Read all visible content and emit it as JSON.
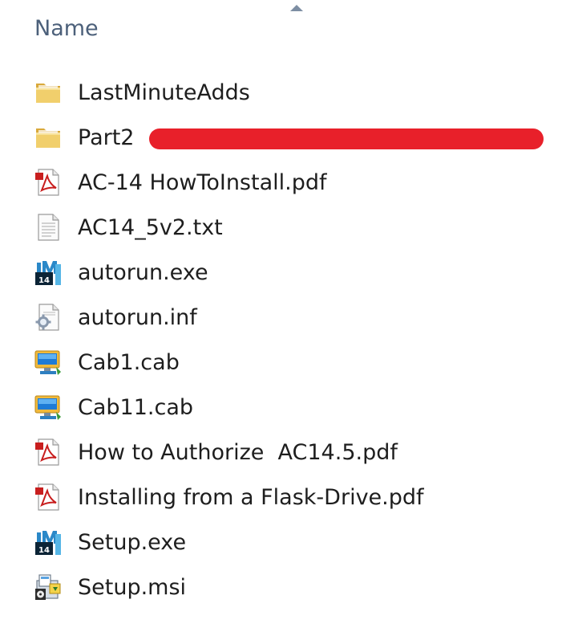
{
  "header": {
    "name_label": "Name",
    "sort_icon": "sort-ascending-icon"
  },
  "files": [
    {
      "label": "LastMinuteAdds",
      "icon": "folder-icon"
    },
    {
      "label": "Part2",
      "icon": "folder-icon"
    },
    {
      "label": "AC-14 HowToInstall.pdf",
      "icon": "pdf-icon"
    },
    {
      "label": "AC14_5v2.txt",
      "icon": "text-file-icon"
    },
    {
      "label": "autorun.exe",
      "icon": "app-exe-icon"
    },
    {
      "label": "autorun.inf",
      "icon": "settings-file-icon"
    },
    {
      "label": "Cab1.cab",
      "icon": "cabinet-icon"
    },
    {
      "label": "Cab11.cab",
      "icon": "cabinet-icon"
    },
    {
      "label": "How to Authorize  AC14.5.pdf",
      "icon": "pdf-icon"
    },
    {
      "label": "Installing from a Flask-Drive.pdf",
      "icon": "pdf-icon"
    },
    {
      "label": "Setup.exe",
      "icon": "app-exe-icon"
    },
    {
      "label": "Setup.msi",
      "icon": "installer-icon"
    }
  ],
  "colors": {
    "redaction": "#e8202a",
    "header_text": "#4c607a"
  }
}
